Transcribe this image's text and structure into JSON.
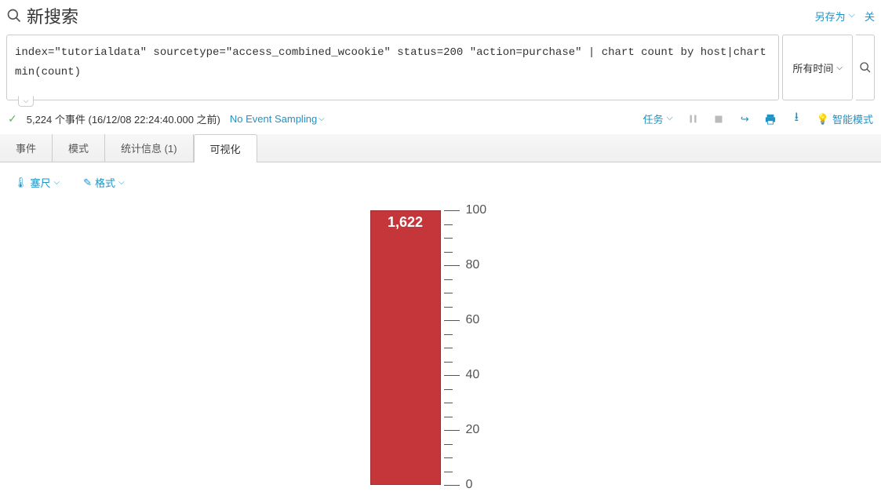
{
  "header": {
    "title": "新搜索",
    "save_as_label": "另存为",
    "more_label": "关"
  },
  "search": {
    "query": "index=\"tutorialdata\"  sourcetype=\"access_combined_wcookie\" status=200 \"action=purchase\" | chart count by host|chart min(count)",
    "time_picker_label": "所有时间"
  },
  "status": {
    "events_text": "5,224 个事件 (16/12/08 22:24:40.000 之前)",
    "sampling_label": "No Event Sampling",
    "tasks_label": "任务",
    "smart_mode_label": "智能模式"
  },
  "tabs": {
    "events": "事件",
    "patterns": "模式",
    "statistics": "统计信息 (1)",
    "visualization": "可视化"
  },
  "tools": {
    "ruler_label": "塞尺",
    "format_label": "格式"
  },
  "chart_data": {
    "type": "bar",
    "value": 1622,
    "value_label": "1,622",
    "scale_min": 0,
    "scale_max": 100,
    "ticks": [
      0,
      20,
      40,
      60,
      80,
      100
    ],
    "minor_step": 5,
    "bar_color": "#c4363a"
  }
}
